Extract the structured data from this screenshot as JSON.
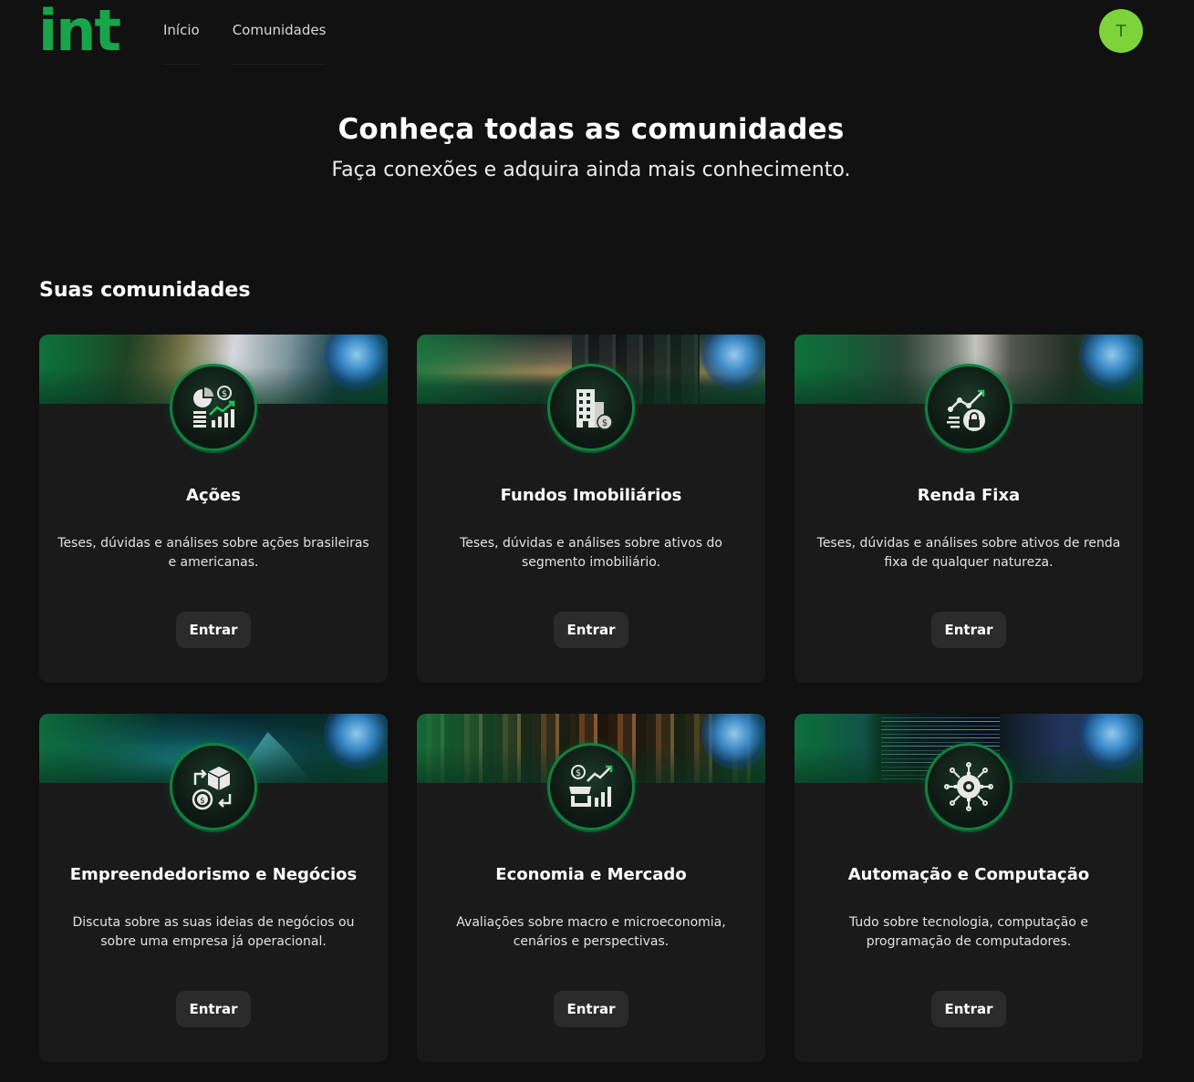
{
  "header": {
    "logo": "int",
    "nav": [
      {
        "label": "Início"
      },
      {
        "label": "Comunidades"
      }
    ],
    "avatar_initial": "T"
  },
  "hero": {
    "title": "Conheça todas as comunidades",
    "subtitle": "Faça conexões e adquira ainda mais conhecimento."
  },
  "section": {
    "title": "Suas comunidades"
  },
  "communities": [
    {
      "title": "Ações",
      "description": "Teses, dúvidas e análises sobre ações brasileiras e americanas.",
      "button": "Entrar",
      "icon": "chart-money-icon"
    },
    {
      "title": "Fundos Imobiliários",
      "description": "Teses, dúvidas e análises sobre ativos do segmento imobiliário.",
      "button": "Entrar",
      "icon": "building-money-icon"
    },
    {
      "title": "Renda Fixa",
      "description": "Teses, dúvidas e análises sobre ativos de renda fixa de qualquer natureza.",
      "button": "Entrar",
      "icon": "growth-lock-icon"
    },
    {
      "title": "Empreendedorismo e Negócios",
      "description": "Discuta sobre as suas ideias de negócios ou sobre uma empresa já operacional.",
      "button": "Entrar",
      "icon": "exchange-box-icon"
    },
    {
      "title": "Economia e Mercado",
      "description": "Avaliações sobre macro e microeconomia, cenários e perspectivas.",
      "button": "Entrar",
      "icon": "market-growth-icon"
    },
    {
      "title": "Automação e Computação",
      "description": "Tudo sobre tecnologia, computação e programação de computadores.",
      "button": "Entrar",
      "icon": "gear-circuit-icon"
    }
  ],
  "colors": {
    "background": "#111111",
    "card": "#1a1a1a",
    "brand_green": "#17a54a",
    "avatar": "#7ed23a",
    "button": "#2b2b2b"
  }
}
